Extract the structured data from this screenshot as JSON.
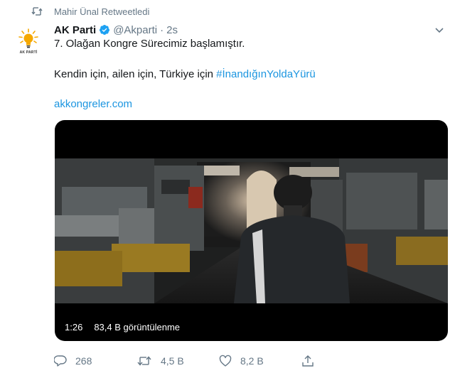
{
  "retweet": {
    "text": "Mahir Ünal Retweetledi"
  },
  "author": {
    "name": "AK Parti",
    "handle": "@Akparti",
    "separator": "·",
    "time": "2s",
    "avatar_text": "AK PARTİ"
  },
  "body": {
    "line1": "7. Olağan Kongre Sürecimiz başlamıştır.",
    "line2_prefix": "Kendin için, ailen için, Türkiye için ",
    "hashtag": "#İnandığınYoldaYürü",
    "link": "akkongreler.com"
  },
  "media": {
    "duration": "1:26",
    "views": "83,4 B görüntülenme"
  },
  "actions": {
    "reply_count": "268",
    "retweet_count": "4,5 B",
    "like_count": "8,2 B"
  },
  "colors": {
    "link": "#1b95e0",
    "muted": "#657786",
    "text": "#14171a",
    "logo_yellow": "#f5a800"
  },
  "icons": [
    "retweet-icon",
    "verified-badge-icon",
    "chevron-down-icon",
    "reply-icon",
    "retweet-action-icon",
    "like-icon",
    "share-icon",
    "ak-parti-logo"
  ]
}
